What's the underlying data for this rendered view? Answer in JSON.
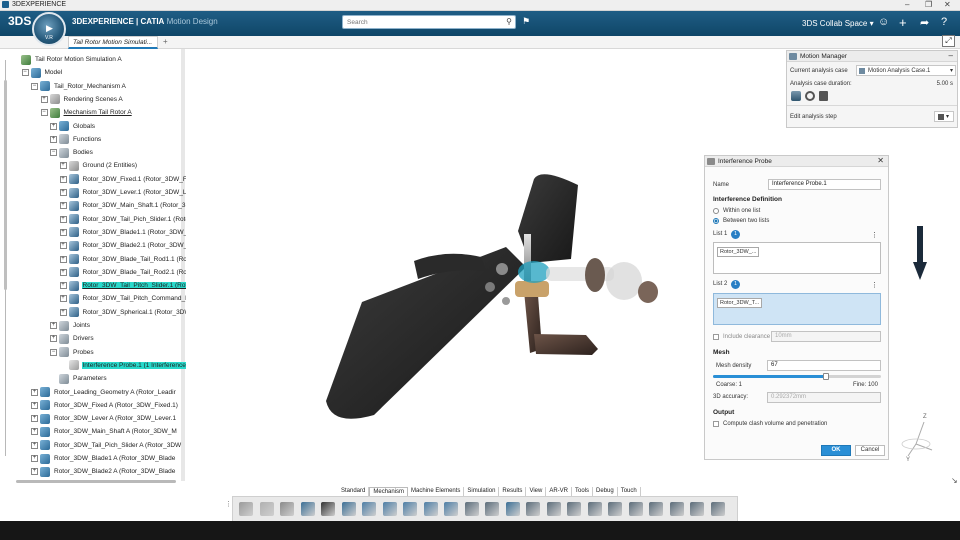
{
  "window": {
    "title": "3DEXPERIENCE",
    "controls": [
      "–",
      "❐",
      "✕"
    ]
  },
  "header": {
    "logo": "3DS",
    "compass": {
      "play_icon": "play-icon",
      "version": "V.R"
    },
    "brand_bold": "3DEXPERIENCE | CATIA",
    "brand_sub": "Motion Design",
    "search_placeholder": "Search",
    "collab_space": "3DS Collab Space",
    "icons": [
      "user-icon",
      "plus-icon",
      "share-icon",
      "help-icon"
    ]
  },
  "tabs": {
    "active": "Tail Rotor Motion Simulati...",
    "add": "+"
  },
  "tree": {
    "rows": [
      {
        "label": "Tail Rotor Motion Simulation A",
        "indent": 0,
        "icon": "ic-mech",
        "exp": ""
      },
      {
        "label": "Model",
        "indent": 1,
        "icon": "ic-prod",
        "exp": "−"
      },
      {
        "label": "Tail_Rotor_Mechanism A",
        "indent": 2,
        "icon": "ic-prod",
        "exp": "−"
      },
      {
        "label": "Rendering Scenes A",
        "indent": 3,
        "icon": "ic-gray",
        "exp": "+"
      },
      {
        "label": "Mechanism Tail Rotor A",
        "indent": 3,
        "icon": "ic-mech",
        "exp": "−",
        "style": "ul"
      },
      {
        "label": "Globals",
        "indent": 4,
        "icon": "ic-prod",
        "exp": "+"
      },
      {
        "label": "Functions",
        "indent": 4,
        "icon": "ic-folder",
        "exp": "+"
      },
      {
        "label": "Bodies",
        "indent": 4,
        "icon": "ic-folder",
        "exp": "−"
      },
      {
        "label": "Ground (2 Entities)",
        "indent": 5,
        "icon": "ic-gray",
        "exp": "+"
      },
      {
        "label": "Rotor_3DW_Fixed.1 (Rotor_3DW_Fi",
        "indent": 5,
        "icon": "ic-body",
        "exp": "+"
      },
      {
        "label": "Rotor_3DW_Lever.1 (Rotor_3DW_Le",
        "indent": 5,
        "icon": "ic-body",
        "exp": "+"
      },
      {
        "label": "Rotor_3DW_Main_Shaft.1 (Rotor_3D",
        "indent": 5,
        "icon": "ic-body",
        "exp": "+"
      },
      {
        "label": "Rotor_3DW_Tail_Pich_Slider.1 (Roto",
        "indent": 5,
        "icon": "ic-body",
        "exp": "+"
      },
      {
        "label": "Rotor_3DW_Blade1.1 (Rotor_3DW_",
        "indent": 5,
        "icon": "ic-body",
        "exp": "+"
      },
      {
        "label": "Rotor_3DW_Blade2.1 (Rotor_3DW_",
        "indent": 5,
        "icon": "ic-body",
        "exp": "+"
      },
      {
        "label": "Rotor_3DW_Blade_Tail_Rod1.1 (Rot",
        "indent": 5,
        "icon": "ic-body",
        "exp": "+"
      },
      {
        "label": "Rotor_3DW_Blade_Tail_Rod2.1 (Rot",
        "indent": 5,
        "icon": "ic-body",
        "exp": "+"
      },
      {
        "label": "Rotor_3DW_Tail_Pitch_Slider.1 (Rot",
        "indent": 5,
        "icon": "ic-body",
        "exp": "+",
        "style": "hl ul"
      },
      {
        "label": "Rotor_3DW_Tail_Pitch_Command_R",
        "indent": 5,
        "icon": "ic-body",
        "exp": "+"
      },
      {
        "label": "Rotor_3DW_Spherical.1 (Rotor_3DW",
        "indent": 5,
        "icon": "ic-body",
        "exp": "+"
      },
      {
        "label": "Joints",
        "indent": 4,
        "icon": "ic-folder",
        "exp": "+"
      },
      {
        "label": "Drivers",
        "indent": 4,
        "icon": "ic-folder",
        "exp": "+"
      },
      {
        "label": "Probes",
        "indent": 4,
        "icon": "ic-folder",
        "exp": "−"
      },
      {
        "label": "Interference Probe.1 (1 Interference",
        "indent": 5,
        "icon": "ic-probe",
        "exp": "",
        "style": "hl"
      },
      {
        "label": "Parameters",
        "indent": 4,
        "icon": "ic-folder",
        "exp": ""
      },
      {
        "label": "Rotor_Leading_Geometry A (Rotor_Leadir",
        "indent": 2,
        "icon": "ic-prod",
        "exp": "+"
      },
      {
        "label": "Rotor_3DW_Fixed A (Rotor_3DW_Fixed.1)",
        "indent": 2,
        "icon": "ic-prod",
        "exp": "+"
      },
      {
        "label": "Rotor_3DW_Lever A (Rotor_3DW_Lever.1",
        "indent": 2,
        "icon": "ic-prod",
        "exp": "+"
      },
      {
        "label": "Rotor_3DW_Main_Shaft A (Rotor_3DW_M",
        "indent": 2,
        "icon": "ic-prod",
        "exp": "+"
      },
      {
        "label": "Rotor_3DW_Tail_Pich_Slider A (Rotor_3DW",
        "indent": 2,
        "icon": "ic-prod",
        "exp": "+"
      },
      {
        "label": "Rotor_3DW_Blade1 A (Rotor_3DW_Blade",
        "indent": 2,
        "icon": "ic-prod",
        "exp": "+"
      },
      {
        "label": "Rotor_3DW_Blade2 A (Rotor_3DW_Blade",
        "indent": 2,
        "icon": "ic-prod",
        "exp": "+"
      }
    ]
  },
  "motion_manager": {
    "title": "Motion Manager",
    "current_case_label": "Current analysis case",
    "current_case_value": "Motion Analysis Case.1",
    "duration_label": "Analysis case duration:",
    "duration_value": "5.00 s",
    "edit_step_label": "Edit analysis step"
  },
  "interference_probe": {
    "title": "Interference Probe",
    "name_label": "Name",
    "name_value": "Interference Probe.1",
    "definition_title": "Interference Definition",
    "within_one_list": "Within one list",
    "between_two_lists": "Between two lists",
    "selected_mode": "between",
    "list1_label": "List 1",
    "list1_count": "1",
    "list1_item": "Rotor_3DW_...",
    "list2_label": "List 2",
    "list2_count": "1",
    "list2_item": "Rotor_3DW_T...",
    "include_clearance_label": "Include clearance",
    "clearance_value": "10mm",
    "mesh_title": "Mesh",
    "mesh_density_label": "Mesh density",
    "mesh_density_value": "67",
    "mesh_density_fraction": 0.67,
    "coarse_label": "Coarse: 1",
    "fine_label": "Fine: 100",
    "accuracy_label": "3D accuracy:",
    "accuracy_value": "0.292372mm",
    "output_title": "Output",
    "compute_label": "Compute clash volume and penetration",
    "ok": "OK",
    "cancel": "Cancel"
  },
  "axes": {
    "z": "Z",
    "y": "Y"
  },
  "toolbar": {
    "tabs": [
      "Standard",
      "Mechanism",
      "Machine Elements",
      "Simulation",
      "Results",
      "View",
      "AR-VR",
      "Tools",
      "Debug",
      "Touch"
    ],
    "active_tab": "Mechanism",
    "tool_icons": [
      "cut-icon",
      "copy-icon",
      "paste-icon",
      "undo-icon",
      "zoom-icon",
      "settings-icon",
      "joint-icon",
      "joint-icon",
      "joint-icon",
      "joint-icon",
      "joint-icon",
      "mechanism-icon",
      "driver-icon",
      "cube-icon",
      "gear-icon",
      "gear-icon",
      "probe-icon",
      "probe-icon",
      "sensor-icon",
      "sensor-icon",
      "sensor-icon",
      "sensor-icon",
      "play-icon",
      "export-icon"
    ]
  }
}
